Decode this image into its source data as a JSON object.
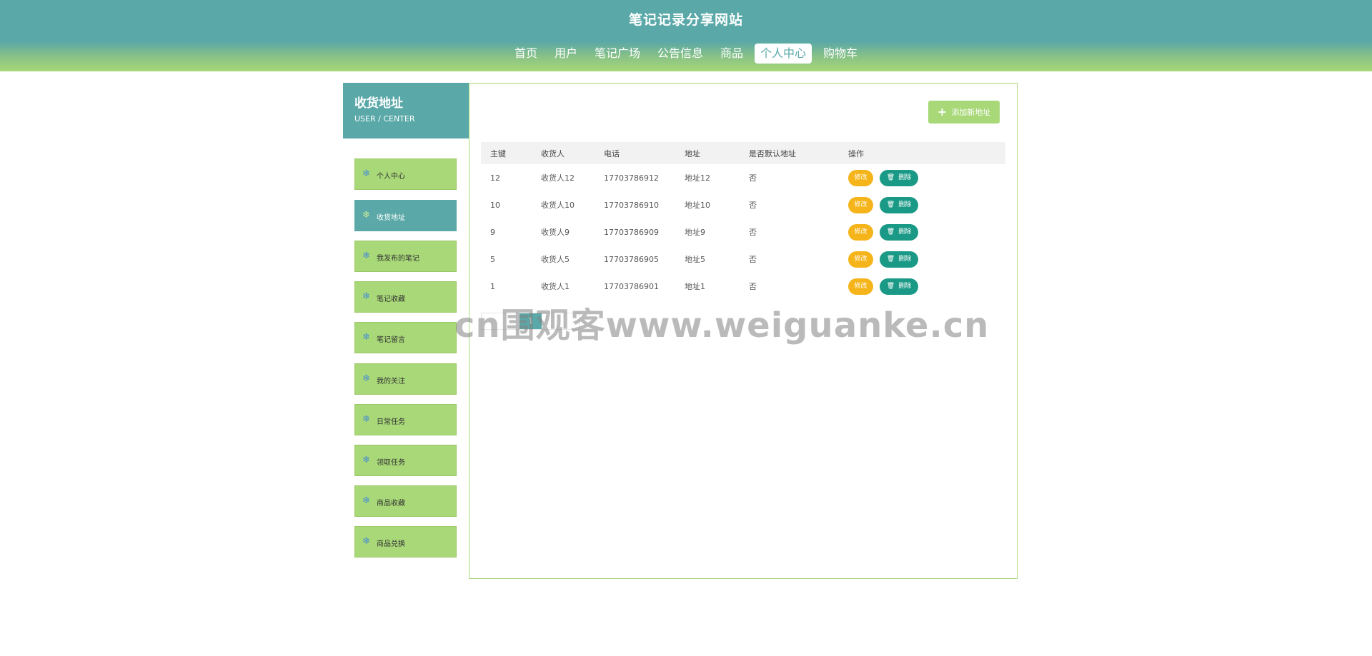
{
  "header": {
    "site_title": "笔记记录分享网站",
    "nav": [
      "首页",
      "用户",
      "笔记广场",
      "公告信息",
      "商品",
      "个人中心",
      "购物车"
    ],
    "active_nav": "个人中心"
  },
  "sidebar": {
    "title": "收货地址",
    "subtitle": "USER / CENTER",
    "items": [
      {
        "label": "个人中心",
        "icon": "snowflake-icon"
      },
      {
        "label": "收货地址",
        "icon": "snowflake-icon",
        "active": true
      },
      {
        "label": "我发布的笔记",
        "icon": "snowflake-icon"
      },
      {
        "label": "笔记收藏",
        "icon": "snowflake-icon"
      },
      {
        "label": "笔记留言",
        "icon": "snowflake-icon"
      },
      {
        "label": "我的关注",
        "icon": "snowflake-icon"
      },
      {
        "label": "日常任务",
        "icon": "snowflake-icon"
      },
      {
        "label": "领取任务",
        "icon": "snowflake-icon"
      },
      {
        "label": "商品收藏",
        "icon": "snowflake-icon"
      },
      {
        "label": "商品兑换",
        "icon": "snowflake-icon"
      }
    ]
  },
  "main": {
    "add_button": "添加新地址",
    "table": {
      "headers": [
        "主键",
        "收货人",
        "电话",
        "地址",
        "是否默认地址",
        "操作"
      ],
      "rows": [
        {
          "id": "12",
          "receiver": "收货人12",
          "phone": "17703786912",
          "address": "地址12",
          "default": "否"
        },
        {
          "id": "10",
          "receiver": "收货人10",
          "phone": "17703786910",
          "address": "地址10",
          "default": "否"
        },
        {
          "id": "9",
          "receiver": "收货人9",
          "phone": "17703786909",
          "address": "地址9",
          "default": "否"
        },
        {
          "id": "5",
          "receiver": "收货人5",
          "phone": "17703786905",
          "address": "地址5",
          "default": "否"
        },
        {
          "id": "1",
          "receiver": "收货人1",
          "phone": "17703786901",
          "address": "地址1",
          "default": "否"
        }
      ],
      "edit_label": "修改",
      "delete_label": "删除"
    },
    "pager_current": "1"
  },
  "watermark": "cn围观客www.weiguanke.cn",
  "colors": {
    "teal": "#5aa8a8",
    "green": "#a8d878",
    "edit_button": "#f5b41a",
    "delete_button": "#1a9a86"
  }
}
